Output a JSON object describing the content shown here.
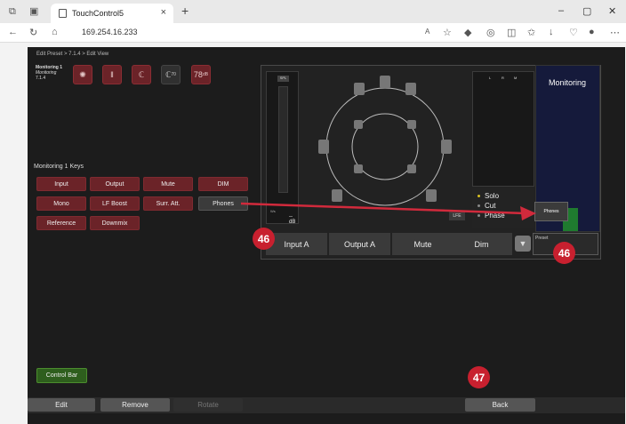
{
  "browser": {
    "tab_title": "TouchControl5",
    "tab_close": "×",
    "new_tab": "+",
    "url": "169.254.16.233",
    "win_min": "–",
    "win_max": "▢",
    "win_close": "✕"
  },
  "app": {
    "breadcrumb": "Edit Preset > 7.1.4 > Edit View",
    "monitoring_name": "Monitoring 1",
    "monitoring_sub": "Monitoring",
    "monitoring_format": "7.1.4",
    "top_level": "78",
    "top_level_unit": "dB",
    "top_ear_num": "70",
    "keys_title": "Monitoring 1 Keys",
    "keys": [
      {
        "label": "Input",
        "style": "red"
      },
      {
        "label": "Output",
        "style": "red"
      },
      {
        "label": "Mute",
        "style": "red"
      },
      {
        "label": "DIM",
        "style": "red"
      },
      {
        "label": "Mono",
        "style": "red"
      },
      {
        "label": "LF Boost",
        "style": "red"
      },
      {
        "label": "Surr. Att.",
        "style": "red"
      },
      {
        "label": "Phones",
        "style": "grey"
      },
      {
        "label": "Reference",
        "style": "red"
      },
      {
        "label": "Downmix",
        "style": "red"
      }
    ],
    "panel": {
      "title": "Monitoring",
      "spl_label": "SPL",
      "meter_db": "--dB",
      "meter_ws": "Ws",
      "lfe": "LFE",
      "rmeter_labels": [
        "L",
        "R",
        "M"
      ],
      "solo_items": [
        {
          "label": "Solo",
          "active": true
        },
        {
          "label": "Cut",
          "active": false
        },
        {
          "label": "Phase",
          "active": false
        }
      ],
      "phones_popup": "Phones",
      "preset_label": "Preset",
      "preset_value": "4",
      "bottom_buttons": [
        "Input A",
        "Output A",
        "Mute",
        "Dim"
      ]
    },
    "badges": {
      "first": "46",
      "second": "46",
      "third": "47"
    },
    "control_bar": "Control Bar",
    "bottom": {
      "edit": "Edit",
      "remove": "Remove",
      "rotate": "Rotate",
      "back": "Back"
    },
    "colors": {
      "accent_red": "#c8202f",
      "key_red": "#6b2328",
      "green": "#2e5e1d",
      "card_blue": "#151a3b"
    }
  }
}
